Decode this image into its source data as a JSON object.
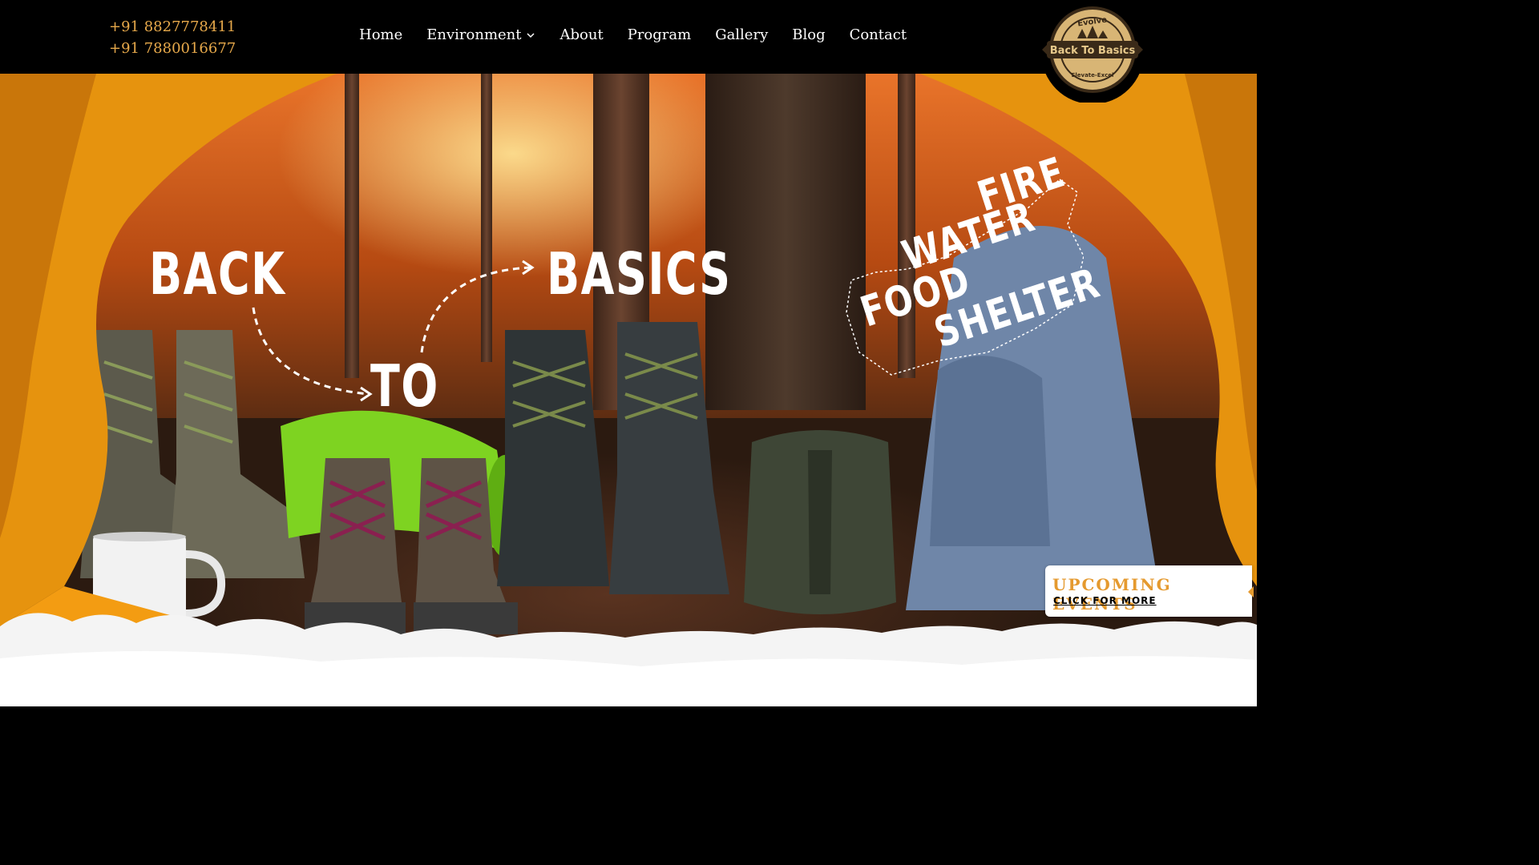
{
  "header": {
    "phones": [
      "+91 8827778411",
      "+91 7880016677"
    ],
    "nav": [
      {
        "label": "Home"
      },
      {
        "label": "Environment",
        "has_dropdown": true
      },
      {
        "label": "About"
      },
      {
        "label": "Program"
      },
      {
        "label": "Gallery"
      },
      {
        "label": "Blog"
      },
      {
        "label": "Contact"
      }
    ],
    "logo": {
      "top_text": "Evolve",
      "main_text": "Back To Basics",
      "bottom_text": "Elevate-Excel"
    }
  },
  "hero": {
    "headline": [
      "BACK",
      "TO",
      "BASICS"
    ],
    "elements": [
      "FIRE",
      "WATER",
      "FOOD",
      "SHELTER"
    ]
  },
  "events": {
    "title": "UPCOMING EVENTS",
    "link": "CLICK FOR MORE"
  },
  "colors": {
    "phone_text": "#e7a94b",
    "accent": "#e59a2f",
    "header_bg": "#000000"
  }
}
